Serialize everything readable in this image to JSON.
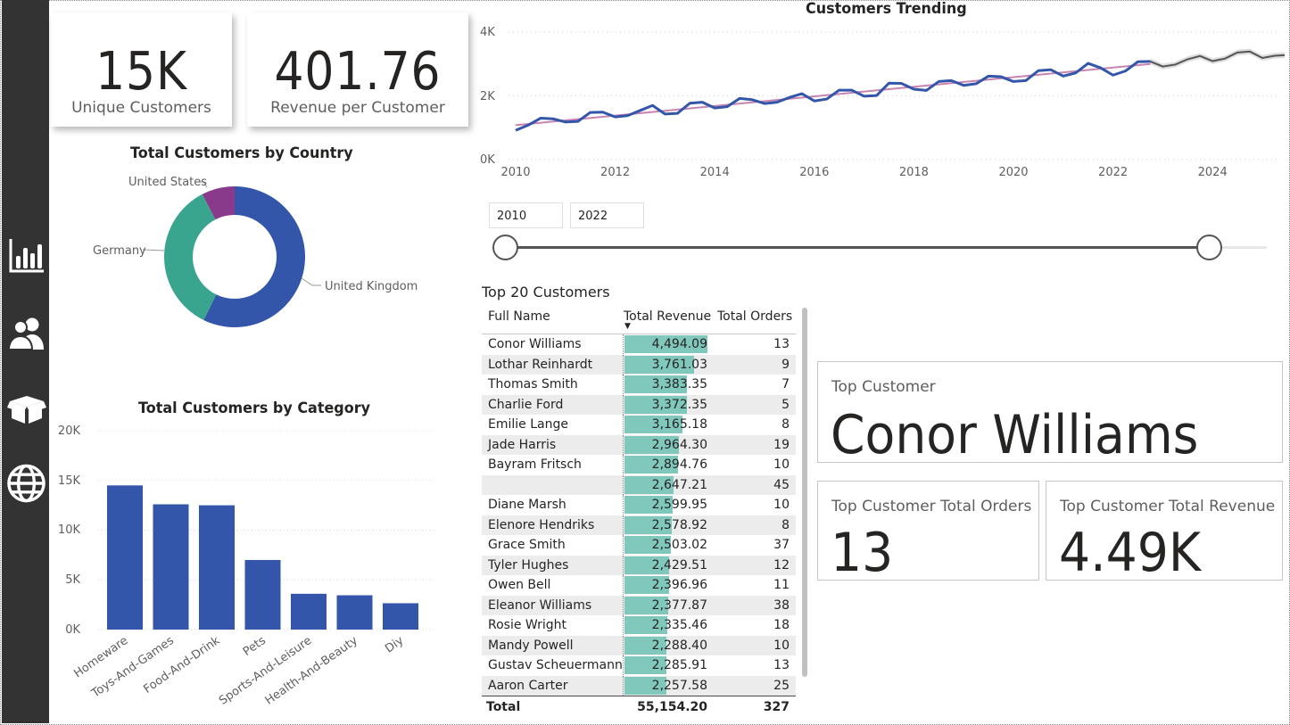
{
  "cards": {
    "unique_customers": {
      "value": "15K",
      "label": "Unique Customers"
    },
    "revenue_per_customer": {
      "value": "401.76",
      "label": "Revenue per Customer"
    }
  },
  "nav_icons": [
    "chart-icon",
    "users-icon",
    "box-icon",
    "globe-icon"
  ],
  "colors": {
    "primary": "#3355aa",
    "teal": "#3aa58f",
    "purple": "#8a3a8a",
    "bar_fill": "#80c7bc",
    "trend": "#c884b0",
    "forecast": "#555555"
  },
  "country_chart": {
    "title": "Total Customers by Country",
    "labels": [
      "United States",
      "Germany",
      "United Kingdom"
    ]
  },
  "category_chart": {
    "title": "Total Customers by Category",
    "yticks": [
      "20K",
      "15K",
      "10K",
      "5K",
      "0K"
    ]
  },
  "trend_chart": {
    "title": "Customers Trending",
    "yticks": [
      "4K",
      "2K",
      "0K"
    ],
    "xticks": [
      "2010",
      "2012",
      "2014",
      "2016",
      "2018",
      "2020",
      "2022",
      "2024"
    ]
  },
  "slider": {
    "start": "2010",
    "end": "2022"
  },
  "table": {
    "title": "Top 20 Customers",
    "headers": [
      "Full Name",
      "Total Revenue",
      "Total Orders"
    ],
    "rows": [
      {
        "name": "Conor Williams",
        "revenue": "4,494.09",
        "orders": "13",
        "rv": 4494.09
      },
      {
        "name": "Lothar Reinhardt",
        "revenue": "3,761.03",
        "orders": "9",
        "rv": 3761.03
      },
      {
        "name": "Thomas Smith",
        "revenue": "3,383.35",
        "orders": "7",
        "rv": 3383.35
      },
      {
        "name": "Charlie Ford",
        "revenue": "3,372.35",
        "orders": "5",
        "rv": 3372.35
      },
      {
        "name": "Emilie Lange",
        "revenue": "3,165.18",
        "orders": "8",
        "rv": 3165.18
      },
      {
        "name": "Jade Harris",
        "revenue": "2,964.30",
        "orders": "19",
        "rv": 2964.3
      },
      {
        "name": "Bayram Fritsch",
        "revenue": "2,894.76",
        "orders": "10",
        "rv": 2894.76
      },
      {
        "name": "",
        "revenue": "2,647.21",
        "orders": "45",
        "rv": 2647.21
      },
      {
        "name": "Diane Marsh",
        "revenue": "2,599.95",
        "orders": "10",
        "rv": 2599.95
      },
      {
        "name": "Elenore Hendriks",
        "revenue": "2,578.92",
        "orders": "8",
        "rv": 2578.92
      },
      {
        "name": "Grace Smith",
        "revenue": "2,503.02",
        "orders": "37",
        "rv": 2503.02
      },
      {
        "name": "Tyler Hughes",
        "revenue": "2,429.51",
        "orders": "12",
        "rv": 2429.51
      },
      {
        "name": "Owen Bell",
        "revenue": "2,396.96",
        "orders": "11",
        "rv": 2396.96
      },
      {
        "name": "Eleanor Williams",
        "revenue": "2,377.87",
        "orders": "38",
        "rv": 2377.87
      },
      {
        "name": "Rosie Wright",
        "revenue": "2,335.46",
        "orders": "18",
        "rv": 2335.46
      },
      {
        "name": "Mandy Powell",
        "revenue": "2,288.40",
        "orders": "10",
        "rv": 2288.4
      },
      {
        "name": "Gustav Scheuermann",
        "revenue": "2,285.91",
        "orders": "13",
        "rv": 2285.91
      },
      {
        "name": "Aaron Carter",
        "revenue": "2,257.58",
        "orders": "25",
        "rv": 2257.58
      }
    ],
    "total": {
      "label": "Total",
      "revenue": "55,154.20",
      "orders": "327"
    }
  },
  "top_customer": {
    "label": "Top Customer",
    "value": "Conor Williams"
  },
  "top_orders": {
    "label": "Top Customer Total Orders",
    "value": "13"
  },
  "top_revenue": {
    "label": "Top Customer Total Revenue",
    "value": "4.49K"
  },
  "chart_data": [
    {
      "type": "pie",
      "title": "Total Customers by Country",
      "categories": [
        "United Kingdom",
        "Germany",
        "United States"
      ],
      "values": [
        8.3,
        5.1,
        1.1
      ],
      "colors": [
        "#3355aa",
        "#3aa58f",
        "#8a3a8a"
      ],
      "donut": true
    },
    {
      "type": "bar",
      "title": "Total Customers by Category",
      "categories": [
        "Homeware",
        "Toys-And-Games",
        "Food-And-Drink",
        "Pets",
        "Sports-And-Leisure",
        "Health-And-Beauty",
        "Diy"
      ],
      "values": [
        14500,
        12600,
        12500,
        7000,
        3600,
        3450,
        2650
      ],
      "ylim": [
        0,
        20000
      ],
      "grid": true
    },
    {
      "type": "line",
      "title": "Customers Trending",
      "xlim": [
        2010,
        2025.5
      ],
      "ylim": [
        0,
        4000
      ],
      "series": [
        {
          "values": [
            [
              2010.0,
              920
            ],
            [
              2010.25,
              1080
            ],
            [
              2010.5,
              1300
            ],
            [
              2010.75,
              1280
            ],
            [
              2011.0,
              1180
            ],
            [
              2011.25,
              1200
            ],
            [
              2011.5,
              1480
            ],
            [
              2011.75,
              1490
            ],
            [
              2012.0,
              1340
            ],
            [
              2012.25,
              1380
            ],
            [
              2012.5,
              1540
            ],
            [
              2012.75,
              1700
            ],
            [
              2013.0,
              1430
            ],
            [
              2013.25,
              1450
            ],
            [
              2013.5,
              1770
            ],
            [
              2013.75,
              1800
            ],
            [
              2014.0,
              1620
            ],
            [
              2014.25,
              1660
            ],
            [
              2014.5,
              1920
            ],
            [
              2014.75,
              1880
            ],
            [
              2015.0,
              1760
            ],
            [
              2015.25,
              1800
            ],
            [
              2015.5,
              1950
            ],
            [
              2015.75,
              2070
            ],
            [
              2016.0,
              1840
            ],
            [
              2016.25,
              1900
            ],
            [
              2016.5,
              2180
            ],
            [
              2016.75,
              2180
            ],
            [
              2017.0,
              1990
            ],
            [
              2017.25,
              2010
            ],
            [
              2017.5,
              2400
            ],
            [
              2017.75,
              2390
            ],
            [
              2018.0,
              2210
            ],
            [
              2018.25,
              2170
            ],
            [
              2018.5,
              2450
            ],
            [
              2018.75,
              2480
            ],
            [
              2019.0,
              2330
            ],
            [
              2019.25,
              2380
            ],
            [
              2019.5,
              2620
            ],
            [
              2019.75,
              2600
            ],
            [
              2020.0,
              2450
            ],
            [
              2020.25,
              2480
            ],
            [
              2020.5,
              2790
            ],
            [
              2020.75,
              2820
            ],
            [
              2021.0,
              2620
            ],
            [
              2021.25,
              2720
            ],
            [
              2021.5,
              3020
            ],
            [
              2021.75,
              2880
            ],
            [
              2022.0,
              2650
            ],
            [
              2022.25,
              2780
            ],
            [
              2022.5,
              3070
            ],
            [
              2022.75,
              3080
            ]
          ]
        },
        {
          "values": [
            [
              2010.0,
              1080
            ],
            [
              2022.75,
              3000
            ]
          ]
        },
        {
          "values": [
            [
              2022.75,
              3080
            ],
            [
              2023.0,
              2920
            ],
            [
              2023.25,
              2980
            ],
            [
              2023.5,
              3150
            ],
            [
              2023.75,
              3250
            ],
            [
              2024.0,
              3090
            ],
            [
              2024.25,
              3170
            ],
            [
              2024.5,
              3360
            ],
            [
              2024.75,
              3390
            ],
            [
              2025.0,
              3190
            ],
            [
              2025.25,
              3260
            ],
            [
              2025.5,
              3280
            ]
          ]
        }
      ]
    }
  ]
}
